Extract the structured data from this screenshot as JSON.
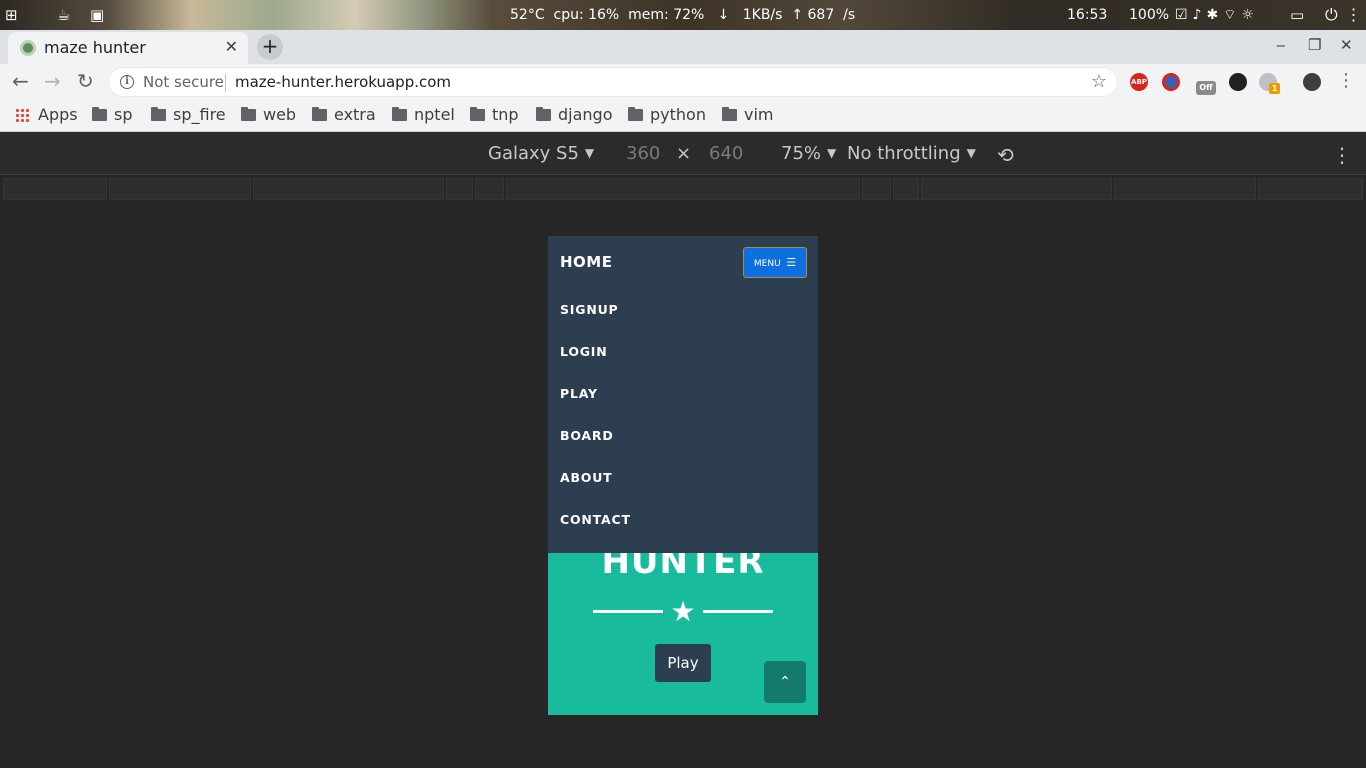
{
  "os": {
    "stats": "52°C  cpu: 16%  mem: 72%   ↓   1KB/s  ↑ 687  /s",
    "clock": "16:53",
    "battery": "100%"
  },
  "browser": {
    "tab_title": "maze hunter",
    "not_secure": "Not secure",
    "url": "maze-hunter.herokuapp.com",
    "bookmarks": [
      "Apps",
      "sp",
      "sp_fire",
      "web",
      "extra",
      "nptel",
      "tnp",
      "django",
      "python",
      "vim"
    ],
    "extensions": {
      "abp": "ABP",
      "off": "Off",
      "badge": "1"
    }
  },
  "devtools": {
    "device": "Galaxy S5",
    "width": "360",
    "times": "×",
    "height": "640",
    "zoom": "75%",
    "throttling": "No throttling"
  },
  "site": {
    "brand": "HOME",
    "menu_label": "MENU",
    "nav": [
      "SIGNUP",
      "LOGIN",
      "PLAY",
      "BOARD",
      "ABOUT",
      "CONTACT"
    ],
    "hero_title": "HUNTER",
    "play_label": "Play",
    "colors": {
      "navbar": "#2c3e50",
      "hero": "#18bc9c",
      "menu_button": "#0d6fe0",
      "scroll_top": "#147b6a"
    }
  }
}
